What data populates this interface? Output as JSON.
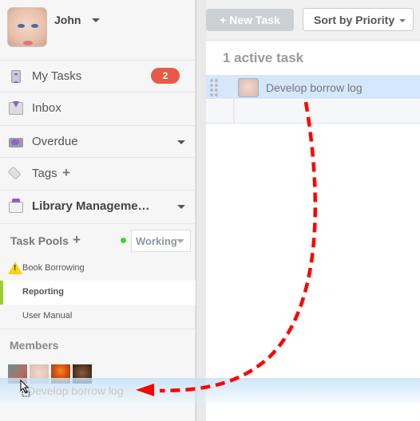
{
  "profile": {
    "name": "John"
  },
  "nav": {
    "my_tasks": {
      "label": "My Tasks",
      "badge": "2",
      "icon": "my-tasks-icon"
    },
    "inbox": {
      "label": "Inbox",
      "icon": "inbox-icon"
    },
    "overdue": {
      "label": "Overdue",
      "icon": "overdue-icon"
    },
    "tags": {
      "label": "Tags",
      "add": "+",
      "icon": "tag-icon"
    },
    "project": {
      "label": "Library Manageme…",
      "icon": "folder-icon"
    }
  },
  "task_pools": {
    "title": "Task Pools",
    "add": "+",
    "status": {
      "value": "Working",
      "color": "#3cd22a"
    },
    "items": [
      {
        "label": "Book Borrowing",
        "warning": true,
        "active": false
      },
      {
        "label": "Reporting",
        "warning": false,
        "active": true
      },
      {
        "label": "User Manual",
        "warning": false,
        "active": false
      }
    ]
  },
  "members": {
    "title": "Members",
    "count": 4
  },
  "toolbar": {
    "new_task": "+ New Task",
    "sort": "Sort by Priority"
  },
  "tasks": {
    "summary": "1 active task",
    "items": [
      {
        "label": "Develop borrow log"
      }
    ]
  },
  "drag": {
    "label": "Develop borrow log"
  },
  "colors": {
    "badge": "#e9594a",
    "accent": "#9acd32",
    "selected_row": "#d4e7fc",
    "annotation_arrow": "#ff0000"
  }
}
